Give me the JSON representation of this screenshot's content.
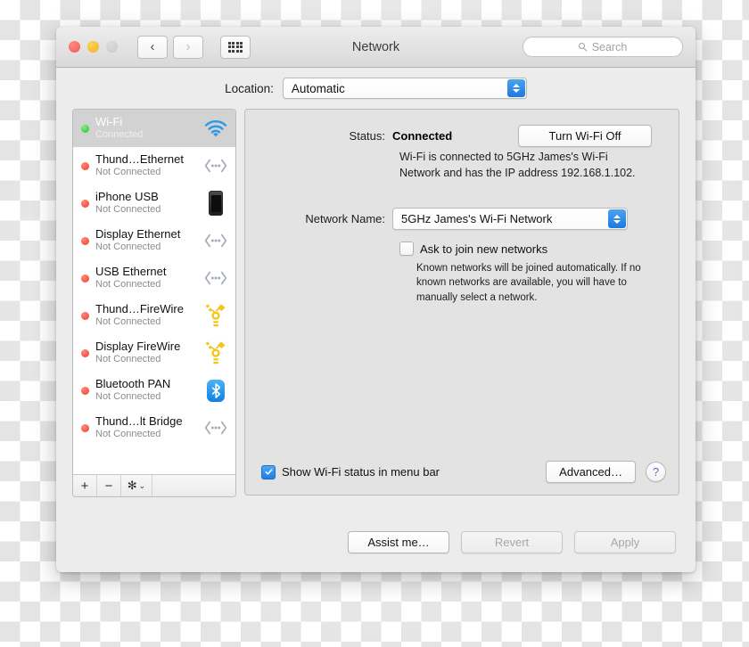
{
  "window": {
    "title": "Network",
    "traffic_lights": [
      "close-red",
      "minimize-yellow",
      "zoom-disabled"
    ],
    "nav": {
      "back": "‹",
      "forward": "›"
    },
    "search": {
      "placeholder": "Search",
      "value": ""
    }
  },
  "location": {
    "label": "Location:",
    "selected": "Automatic"
  },
  "services": [
    {
      "name": "Wi-Fi",
      "state": "Connected",
      "status": "connected",
      "icon": "wifi-icon",
      "selected": true
    },
    {
      "name": "Thund…Ethernet",
      "state": "Not Connected",
      "status": "not-connected",
      "icon": "ethernet-icon",
      "selected": false
    },
    {
      "name": "iPhone USB",
      "state": "Not Connected",
      "status": "not-connected",
      "icon": "iphone-icon",
      "selected": false
    },
    {
      "name": "Display Ethernet",
      "state": "Not Connected",
      "status": "not-connected",
      "icon": "ethernet-icon",
      "selected": false
    },
    {
      "name": "USB Ethernet",
      "state": "Not Connected",
      "status": "not-connected",
      "icon": "ethernet-icon",
      "selected": false
    },
    {
      "name": "Thund…FireWire",
      "state": "Not Connected",
      "status": "not-connected",
      "icon": "firewire-icon",
      "selected": false
    },
    {
      "name": "Display FireWire",
      "state": "Not Connected",
      "status": "not-connected",
      "icon": "firewire-icon",
      "selected": false
    },
    {
      "name": "Bluetooth PAN",
      "state": "Not Connected",
      "status": "not-connected",
      "icon": "bluetooth-icon",
      "selected": false
    },
    {
      "name": "Thund…lt Bridge",
      "state": "Not Connected",
      "status": "not-connected",
      "icon": "ethernet-icon",
      "selected": false
    }
  ],
  "sidebar_toolbar": {
    "add": "+",
    "remove": "−",
    "gear": "✻",
    "gear_chevron": "⌄"
  },
  "panel": {
    "status_label": "Status:",
    "status_value": "Connected",
    "turn_off_button": "Turn Wi-Fi Off",
    "status_description": "Wi-Fi is connected to 5GHz James's Wi-Fi Network and has the IP address 192.168.1.102.",
    "network_name_label": "Network Name:",
    "network_name_value": "5GHz James's Wi-Fi Network",
    "ask_to_join_label": "Ask to join new networks",
    "ask_to_join_checked": false,
    "ask_to_join_hint": "Known networks will be joined automatically. If no known networks are available, you will have to manually select a network.",
    "show_status_label": "Show Wi-Fi status in menu bar",
    "show_status_checked": true,
    "advanced_button": "Advanced…",
    "help_button": "?"
  },
  "footer": {
    "assist_button": "Assist me…",
    "revert_button": "Revert",
    "revert_enabled": false,
    "apply_button": "Apply",
    "apply_enabled": false
  },
  "colors": {
    "accent_blue": "#1f7fe3",
    "connected_green": "#22c322",
    "not_connected_red": "#f0392b",
    "firewire_yellow": "#f5c518",
    "bluetooth_blue": "#1080e0",
    "window_bg": "#ececec",
    "panel_bg": "#e3e3e3"
  }
}
